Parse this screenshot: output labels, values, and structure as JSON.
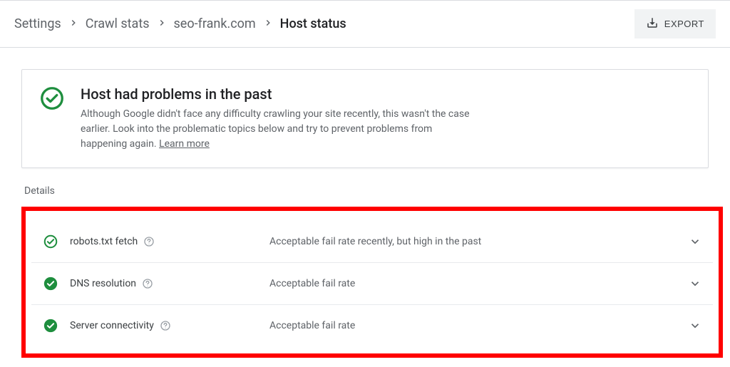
{
  "breadcrumb": {
    "items": [
      {
        "label": "Settings"
      },
      {
        "label": "Crawl stats"
      },
      {
        "label": "seo-frank.com"
      },
      {
        "label": "Host status"
      }
    ]
  },
  "export": {
    "label": "EXPORT"
  },
  "status": {
    "title": "Host had problems in the past",
    "description": "Although Google didn't face any difficulty crawling your site recently, this wasn't the case earlier. Look into the problematic topics below and try to prevent problems from happening again. ",
    "learn_more": "Learn more"
  },
  "details": {
    "label": "Details",
    "rows": [
      {
        "icon": "outline",
        "label": "robots.txt fetch",
        "status": "Acceptable fail rate recently, but high in the past"
      },
      {
        "icon": "filled",
        "label": "DNS resolution",
        "status": "Acceptable fail rate"
      },
      {
        "icon": "filled",
        "label": "Server connectivity",
        "status": "Acceptable fail rate"
      }
    ]
  }
}
